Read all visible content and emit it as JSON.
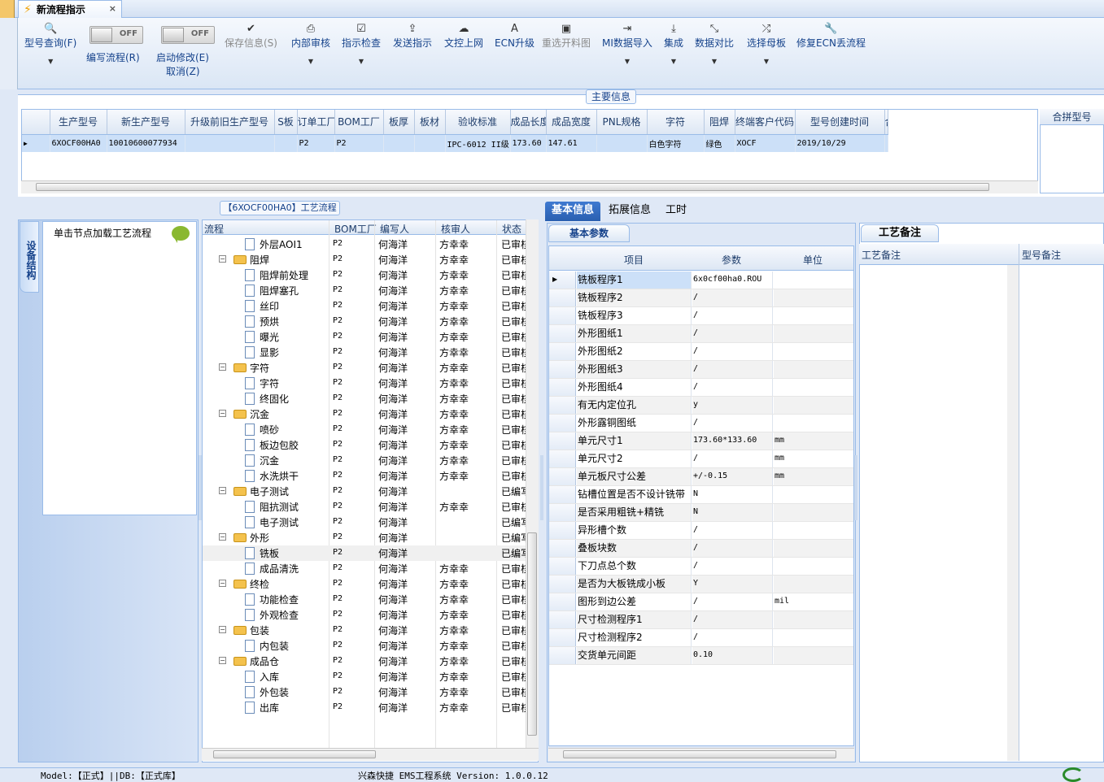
{
  "tab": {
    "title": "新流程指示",
    "close": "×"
  },
  "ribbon": {
    "query": "型号查询(F)",
    "edit_flow": "编写流程(R)",
    "start_modify": "启动修改(E)",
    "cancel": "取消(Z)",
    "toggle_off": "OFF",
    "buttons": [
      "保存信息(S)",
      "内部审核",
      "指示检查",
      "发送指示",
      "文控上网",
      "ECN升级",
      "重选开料图",
      "MI数据导入",
      "集成",
      "数据对比",
      "选择母板",
      "修复ECN丢流程"
    ]
  },
  "main_info": {
    "group_title": "主要信息",
    "columns": [
      "生产型号",
      "新生产型号",
      "升级前旧生产型号",
      "S板",
      "订单工厂",
      "BOM工厂",
      "板厚",
      "板材",
      "验收标准",
      "成品长度",
      "成品宽度",
      "PNL规格",
      "字符",
      "阻焊",
      "终端客户代码",
      "型号创建时间",
      "合"
    ],
    "row": [
      "6XOCF00HA0",
      "10010600077934",
      "",
      "",
      "P2",
      "P2",
      "",
      "",
      "IPC-6012 II级",
      "173.60",
      "147.61",
      "",
      "白色字符",
      "绿色",
      "XOCF",
      "2019/10/29",
      ""
    ],
    "merge_header": "合拼型号"
  },
  "left_panel": {
    "vertical_tab": "设备结构",
    "hint": "单击节点加载工艺流程"
  },
  "process": {
    "title": "【6XOCF00HA0】工艺流程",
    "columns": [
      "流程",
      "BOM工厂",
      "编写人",
      "核审人",
      "状态"
    ],
    "rows": [
      {
        "name": "外层AOI1",
        "level": 1,
        "bom": "P2",
        "editor": "何海洋",
        "reviewer": "方幸幸",
        "status": "已审核"
      },
      {
        "name": "阻焊",
        "level": 0,
        "bom": "P2",
        "editor": "何海洋",
        "reviewer": "方幸幸",
        "status": "已审核"
      },
      {
        "name": "阻焊前处理",
        "level": 1,
        "bom": "P2",
        "editor": "何海洋",
        "reviewer": "方幸幸",
        "status": "已审核"
      },
      {
        "name": "阻焊塞孔",
        "level": 1,
        "bom": "P2",
        "editor": "何海洋",
        "reviewer": "方幸幸",
        "status": "已审核"
      },
      {
        "name": "丝印",
        "level": 1,
        "bom": "P2",
        "editor": "何海洋",
        "reviewer": "方幸幸",
        "status": "已审核"
      },
      {
        "name": "预烘",
        "level": 1,
        "bom": "P2",
        "editor": "何海洋",
        "reviewer": "方幸幸",
        "status": "已审核"
      },
      {
        "name": "曝光",
        "level": 1,
        "bom": "P2",
        "editor": "何海洋",
        "reviewer": "方幸幸",
        "status": "已审核"
      },
      {
        "name": "显影",
        "level": 1,
        "bom": "P2",
        "editor": "何海洋",
        "reviewer": "方幸幸",
        "status": "已审核"
      },
      {
        "name": "字符",
        "level": 0,
        "bom": "P2",
        "editor": "何海洋",
        "reviewer": "方幸幸",
        "status": "已审核"
      },
      {
        "name": "字符",
        "level": 1,
        "bom": "P2",
        "editor": "何海洋",
        "reviewer": "方幸幸",
        "status": "已审核"
      },
      {
        "name": "终固化",
        "level": 1,
        "bom": "P2",
        "editor": "何海洋",
        "reviewer": "方幸幸",
        "status": "已审核"
      },
      {
        "name": "沉金",
        "level": 0,
        "bom": "P2",
        "editor": "何海洋",
        "reviewer": "方幸幸",
        "status": "已审核"
      },
      {
        "name": "喷砂",
        "level": 1,
        "bom": "P2",
        "editor": "何海洋",
        "reviewer": "方幸幸",
        "status": "已审核"
      },
      {
        "name": "板边包胶",
        "level": 1,
        "bom": "P2",
        "editor": "何海洋",
        "reviewer": "方幸幸",
        "status": "已审核"
      },
      {
        "name": "沉金",
        "level": 1,
        "bom": "P2",
        "editor": "何海洋",
        "reviewer": "方幸幸",
        "status": "已审核"
      },
      {
        "name": "水洗烘干",
        "level": 1,
        "bom": "P2",
        "editor": "何海洋",
        "reviewer": "方幸幸",
        "status": "已审核"
      },
      {
        "name": "电子测试",
        "level": 0,
        "bom": "P2",
        "editor": "何海洋",
        "reviewer": "",
        "status": "已编写"
      },
      {
        "name": "阻抗测试",
        "level": 1,
        "bom": "P2",
        "editor": "何海洋",
        "reviewer": "方幸幸",
        "status": "已审核"
      },
      {
        "name": "电子测试",
        "level": 1,
        "bom": "P2",
        "editor": "何海洋",
        "reviewer": "",
        "status": "已编写"
      },
      {
        "name": "外形",
        "level": 0,
        "bom": "P2",
        "editor": "何海洋",
        "reviewer": "",
        "status": "已编写"
      },
      {
        "name": "铣板",
        "level": 1,
        "bom": "P2",
        "editor": "何海洋",
        "reviewer": "",
        "status": "已编写"
      },
      {
        "name": "成品清洗",
        "level": 1,
        "bom": "P2",
        "editor": "何海洋",
        "reviewer": "方幸幸",
        "status": "已审核"
      },
      {
        "name": "终检",
        "level": 0,
        "bom": "P2",
        "editor": "何海洋",
        "reviewer": "方幸幸",
        "status": "已审核"
      },
      {
        "name": "功能检查",
        "level": 1,
        "bom": "P2",
        "editor": "何海洋",
        "reviewer": "方幸幸",
        "status": "已审核"
      },
      {
        "name": "外观检查",
        "level": 1,
        "bom": "P2",
        "editor": "何海洋",
        "reviewer": "方幸幸",
        "status": "已审核"
      },
      {
        "name": "包装",
        "level": 0,
        "bom": "P2",
        "editor": "何海洋",
        "reviewer": "方幸幸",
        "status": "已审核"
      },
      {
        "name": "内包装",
        "level": 1,
        "bom": "P2",
        "editor": "何海洋",
        "reviewer": "方幸幸",
        "status": "已审核"
      },
      {
        "name": "成品仓",
        "level": 0,
        "bom": "P2",
        "editor": "何海洋",
        "reviewer": "方幸幸",
        "status": "已审核"
      },
      {
        "name": "入库",
        "level": 1,
        "bom": "P2",
        "editor": "何海洋",
        "reviewer": "方幸幸",
        "status": "已审核"
      },
      {
        "name": "外包装",
        "level": 1,
        "bom": "P2",
        "editor": "何海洋",
        "reviewer": "方幸幸",
        "status": "已审核"
      },
      {
        "name": "出库",
        "level": 1,
        "bom": "P2",
        "editor": "何海洋",
        "reviewer": "方幸幸",
        "status": "已审核"
      }
    ]
  },
  "right_tabs": [
    "基本信息",
    "拓展信息",
    "工时"
  ],
  "basic": {
    "title": "基本参数",
    "columns": [
      "项目",
      "参数",
      "单位"
    ],
    "rows": [
      {
        "item": "铣板程序1",
        "value": "6x0cf00ha0.ROU",
        "unit": ""
      },
      {
        "item": "铣板程序2",
        "value": "/",
        "unit": ""
      },
      {
        "item": "铣板程序3",
        "value": "/",
        "unit": ""
      },
      {
        "item": "外形图纸1",
        "value": "/",
        "unit": ""
      },
      {
        "item": "外形图纸2",
        "value": "/",
        "unit": ""
      },
      {
        "item": "外形图纸3",
        "value": "/",
        "unit": ""
      },
      {
        "item": "外形图纸4",
        "value": "/",
        "unit": ""
      },
      {
        "item": "有无内定位孔",
        "value": "y",
        "unit": ""
      },
      {
        "item": "外形露铜图纸",
        "value": "/",
        "unit": ""
      },
      {
        "item": "单元尺寸1",
        "value": "173.60*133.60",
        "unit": "mm"
      },
      {
        "item": "单元尺寸2",
        "value": "/",
        "unit": "mm"
      },
      {
        "item": "单元板尺寸公差",
        "value": "+/-0.15",
        "unit": "mm"
      },
      {
        "item": "钻槽位置是否不设计铣带",
        "value": "N",
        "unit": ""
      },
      {
        "item": "是否采用粗铣+精铣",
        "value": "N",
        "unit": ""
      },
      {
        "item": "异形槽个数",
        "value": "/",
        "unit": ""
      },
      {
        "item": "叠板块数",
        "value": "/",
        "unit": ""
      },
      {
        "item": "下刀点总个数",
        "value": "/",
        "unit": ""
      },
      {
        "item": "是否为大板铣成小板",
        "value": "Y",
        "unit": ""
      },
      {
        "item": "图形到边公差",
        "value": "/",
        "unit": "mil"
      },
      {
        "item": "尺寸检测程序1",
        "value": "/",
        "unit": ""
      },
      {
        "item": "尺寸检测程序2",
        "value": "/",
        "unit": ""
      },
      {
        "item": "交货单元间距",
        "value": "0.10",
        "unit": ""
      }
    ]
  },
  "notes": {
    "tab": "工艺备注",
    "col1": "工艺备注",
    "col2": "型号备注"
  },
  "status": {
    "model": "Model:【正式】||DB:【正式库】",
    "app": "兴森快捷 EMS工程系统 Version: 1.0.0.12"
  }
}
